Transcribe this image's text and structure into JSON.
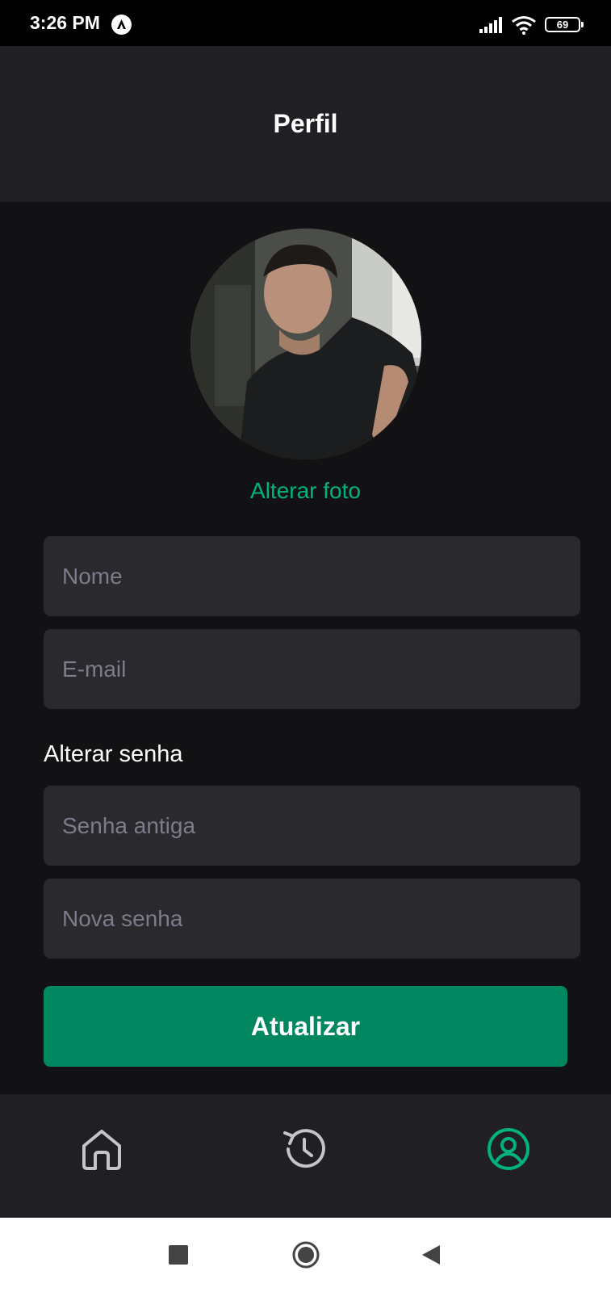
{
  "status_bar": {
    "time": "3:26 PM",
    "battery_level": "69"
  },
  "header": {
    "title": "Perfil"
  },
  "profile": {
    "change_photo_label": "Alterar foto"
  },
  "form": {
    "name_placeholder": "Nome",
    "email_placeholder": "E-mail",
    "password_section_label": "Alterar senha",
    "old_password_placeholder": "Senha antiga",
    "new_password_placeholder": "Nova senha",
    "submit_label": "Atualizar"
  },
  "tab_bar": {
    "tabs": [
      {
        "icon": "home-icon",
        "active": false
      },
      {
        "icon": "history-icon",
        "active": false
      },
      {
        "icon": "user-circle-icon",
        "active": true
      }
    ]
  },
  "colors": {
    "accent": "#00B37E",
    "button": "#00875F",
    "background": "#121214",
    "surface": "#202024",
    "input": "#29292E",
    "placeholder": "#7C7C8A",
    "inactive_icon": "#C4C4CC"
  }
}
